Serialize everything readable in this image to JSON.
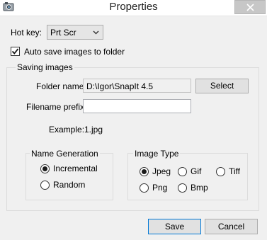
{
  "window": {
    "title": "Properties",
    "icons": {
      "app": "camera-icon",
      "close": "close-icon"
    }
  },
  "hotkey": {
    "label": "Hot key:",
    "value": "Prt Scr"
  },
  "autosave": {
    "label": "Auto save images to folder",
    "checked": true
  },
  "saving": {
    "legend": "Saving images",
    "folder_label": "Folder name:",
    "folder_value": "D:\\Igor\\SnapIt 4.5",
    "select_button": "Select",
    "prefix_label": "Filename prefix:",
    "prefix_value": "",
    "example_label": "Example:",
    "example_value": "1.jpg"
  },
  "name_generation": {
    "legend": "Name Generation",
    "options": [
      {
        "label": "Incremental",
        "selected": true
      },
      {
        "label": "Random",
        "selected": false
      }
    ]
  },
  "image_type": {
    "legend": "Image Type",
    "options": [
      {
        "label": "Jpeg",
        "selected": true
      },
      {
        "label": "Gif",
        "selected": false
      },
      {
        "label": "Tiff",
        "selected": false
      },
      {
        "label": "Png",
        "selected": false
      },
      {
        "label": "Bmp",
        "selected": false
      }
    ]
  },
  "buttons": {
    "save": "Save",
    "cancel": "Cancel"
  }
}
